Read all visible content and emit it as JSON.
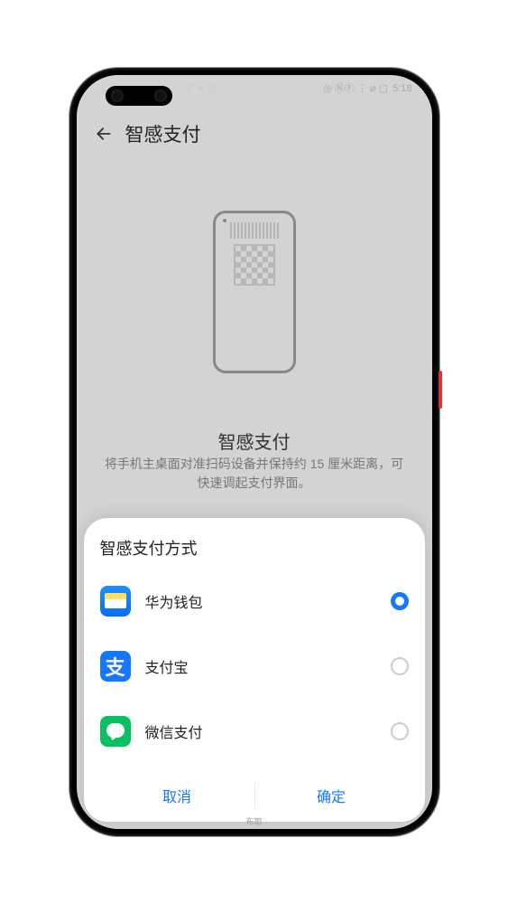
{
  "status": {
    "left_icons": "ᯤ ✈ ▤",
    "right_icons": "◎ ⓃⒻ ⋮ ⌀ ▢",
    "time": "5:18"
  },
  "header": {
    "title": "智感支付"
  },
  "feature": {
    "title": "智感支付",
    "description": "将手机主桌面对准扫码设备并保持约 15 厘米距离，可快速调起支付界面。"
  },
  "sheet": {
    "title": "智感支付方式",
    "options": [
      {
        "label": "华为钱包",
        "selected": true
      },
      {
        "label": "支付宝",
        "selected": false
      },
      {
        "label": "微信支付",
        "selected": false
      }
    ],
    "cancel": "取消",
    "confirm": "确定"
  },
  "alipay_glyph": "支",
  "watermark": "布耶"
}
